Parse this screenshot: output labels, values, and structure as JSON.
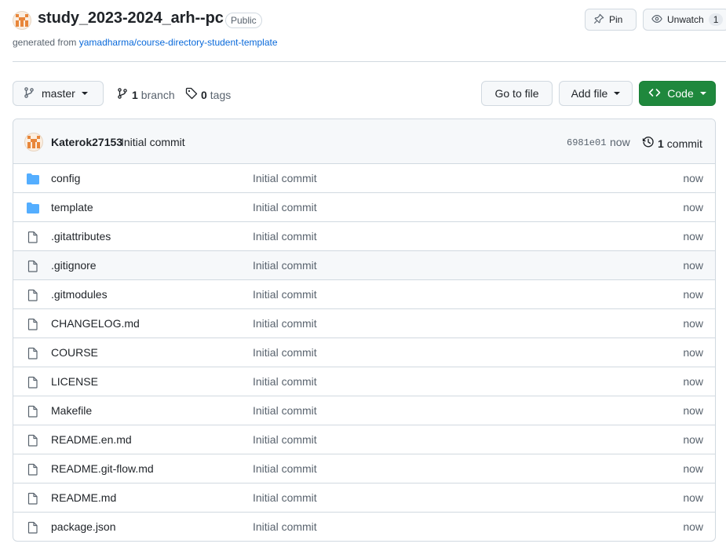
{
  "repo": {
    "owner_avatar": "identicon",
    "title": "study_2023-2024_arh--pc",
    "visibility": "Public",
    "generated_prefix": "generated from",
    "generated_link": "yamadharma/course-directory-student-template"
  },
  "header_actions": {
    "pin_label": "Pin",
    "unwatch_label": "Unwatch",
    "watch_count": "1"
  },
  "toolbar": {
    "branch_name": "master",
    "branch_count": "1",
    "branch_word": "branch",
    "tag_count": "0",
    "tag_word": "tags",
    "goto_file": "Go to file",
    "add_file": "Add file",
    "code": "Code"
  },
  "latest_commit": {
    "author": "Katerok27153",
    "message": "Initial commit",
    "sha": "6981e01",
    "time": "now",
    "commit_count": "1",
    "commit_word": "commit"
  },
  "files": [
    {
      "name": "config",
      "type": "dir",
      "message": "Initial commit",
      "time": "now"
    },
    {
      "name": "template",
      "type": "dir",
      "message": "Initial commit",
      "time": "now"
    },
    {
      "name": ".gitattributes",
      "type": "file",
      "message": "Initial commit",
      "time": "now"
    },
    {
      "name": ".gitignore",
      "type": "file",
      "message": "Initial commit",
      "time": "now"
    },
    {
      "name": ".gitmodules",
      "type": "file",
      "message": "Initial commit",
      "time": "now"
    },
    {
      "name": "CHANGELOG.md",
      "type": "file",
      "message": "Initial commit",
      "time": "now"
    },
    {
      "name": "COURSE",
      "type": "file",
      "message": "Initial commit",
      "time": "now"
    },
    {
      "name": "LICENSE",
      "type": "file",
      "message": "Initial commit",
      "time": "now"
    },
    {
      "name": "Makefile",
      "type": "file",
      "message": "Initial commit",
      "time": "now"
    },
    {
      "name": "README.en.md",
      "type": "file",
      "message": "Initial commit",
      "time": "now"
    },
    {
      "name": "README.git-flow.md",
      "type": "file",
      "message": "Initial commit",
      "time": "now"
    },
    {
      "name": "README.md",
      "type": "file",
      "message": "Initial commit",
      "time": "now"
    },
    {
      "name": "package.json",
      "type": "file",
      "message": "Initial commit",
      "time": "now"
    }
  ],
  "colors": {
    "accent_link": "#0969da",
    "code_button": "#1f883d",
    "folder_icon": "#54aeff",
    "avatar_orange": "#e8863a"
  }
}
